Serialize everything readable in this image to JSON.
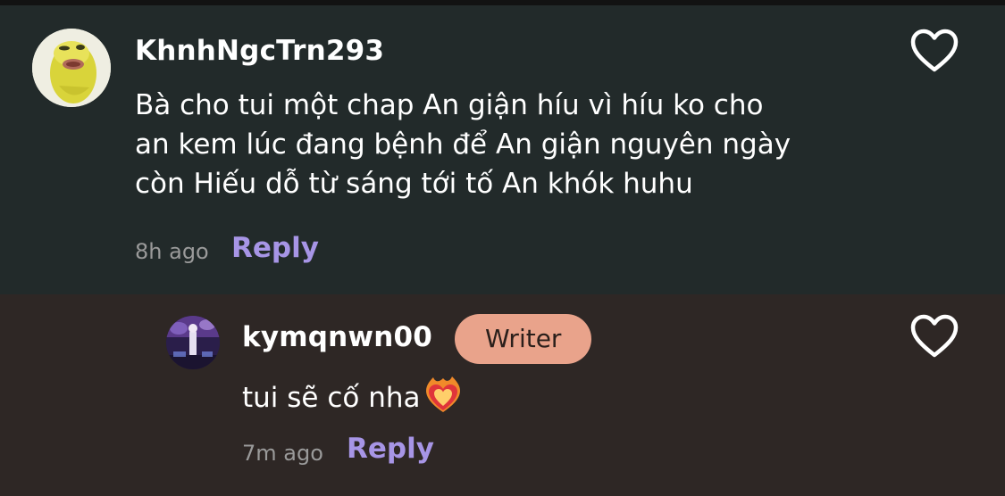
{
  "comment": {
    "username": "KhnhNgcTrn293",
    "avatar_icon": "yellow-character-avatar",
    "text_lines": [
      "Bà cho tui một chap An giận híu vì híu ko cho",
      "an kem lúc đang bệnh để An giận nguyên ngày",
      "còn Hiếu dỗ từ sáng tới tố An khók huhu"
    ],
    "time": "8h ago",
    "reply_label": "Reply",
    "like_icon": "heart-outline-icon"
  },
  "reply": {
    "username": "kymqnwn00",
    "avatar_icon": "concert-photo-avatar",
    "badge": "Writer",
    "text": "tui sẽ cố nha",
    "emoji_icon": "heart-on-fire-icon",
    "time": "7m ago",
    "reply_label": "Reply",
    "like_icon": "heart-outline-icon"
  },
  "colors": {
    "comment_bg": "#222a2a",
    "reply_bg": "#2e2725",
    "accent": "#a795e6",
    "badge_bg": "#e9a38b",
    "muted_text": "#9a9a9a"
  }
}
